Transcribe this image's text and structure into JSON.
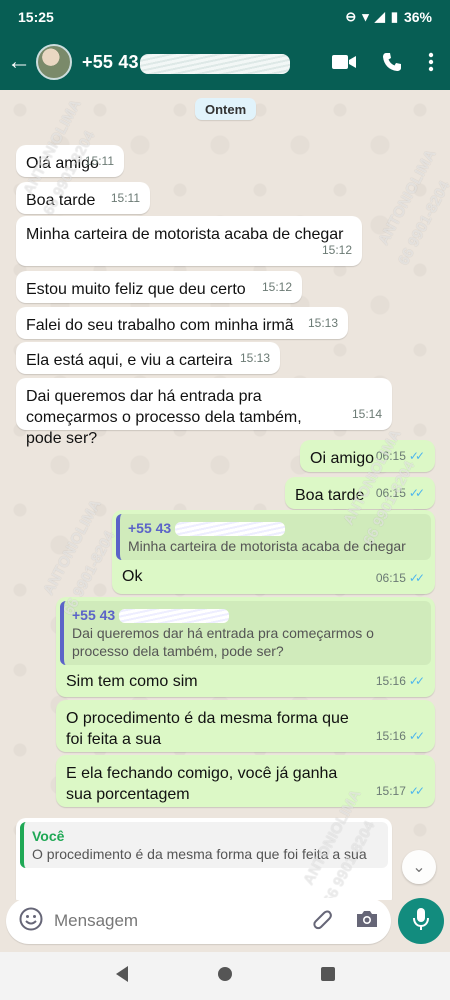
{
  "status_bar": {
    "time": "15:25",
    "battery": "36%"
  },
  "header": {
    "contact_name": "+55 43"
  },
  "chat": {
    "date_separator": "Ontem",
    "messages": [
      {
        "dir": "in",
        "text": "Olá amigo",
        "time": "15:11"
      },
      {
        "dir": "in",
        "text": "Boa tarde",
        "time": "15:11"
      },
      {
        "dir": "in",
        "text": "Minha carteira de motorista acaba de chegar",
        "time": "15:12"
      },
      {
        "dir": "in",
        "text": "Estou muito feliz que deu certo",
        "time": "15:12"
      },
      {
        "dir": "in",
        "text": "Falei do seu trabalho com minha irmã",
        "time": "15:13"
      },
      {
        "dir": "in",
        "text": "Ela está aqui, e viu a carteira",
        "time": "15:13"
      },
      {
        "dir": "in",
        "text": "Dai queremos dar há entrada pra começarmos o processo dela também, pode ser?",
        "time": "15:14"
      },
      {
        "dir": "out",
        "text": "Oi amigo",
        "time": "06:15"
      },
      {
        "dir": "out",
        "text": "Boa tarde",
        "time": "06:15"
      },
      {
        "dir": "out",
        "text": "Ok",
        "time": "06:15",
        "quote_name": "+55 43",
        "quote_text": "Minha carteira de motorista acaba de chegar"
      },
      {
        "dir": "out",
        "text": "Sim tem como sim",
        "time": "15:16",
        "quote_name": "+55 43",
        "quote_text": "Dai queremos dar há entrada pra começarmos o processo dela também, pode ser?"
      },
      {
        "dir": "out",
        "text": "O procedimento é da mesma forma que foi feita a sua",
        "time": "15:16"
      },
      {
        "dir": "out",
        "text": "E ela fechando comigo, você já ganha sua porcentagem",
        "time": "15:17"
      },
      {
        "dir": "in",
        "text": "",
        "time": "",
        "quote_name": "Você",
        "quote_text": "O procedimento é da mesma forma que foi feita a sua"
      }
    ]
  },
  "watermark": {
    "name": "ANTONIOLIMA",
    "phone": "66 9901-8204"
  },
  "composer": {
    "placeholder": "Mensagem"
  },
  "colors": {
    "header": "#075e54",
    "outgoing": "#dcf8c6",
    "incoming": "#ffffff",
    "read_tick": "#4fb6ec",
    "mic": "#128c7e"
  },
  "icons": [
    "back-arrow-icon",
    "video-call-icon",
    "phone-icon",
    "more-vert-icon",
    "emoji-icon",
    "attach-icon",
    "camera-icon",
    "mic-icon",
    "back-nav-icon",
    "home-nav-icon",
    "recents-nav-icon"
  ]
}
